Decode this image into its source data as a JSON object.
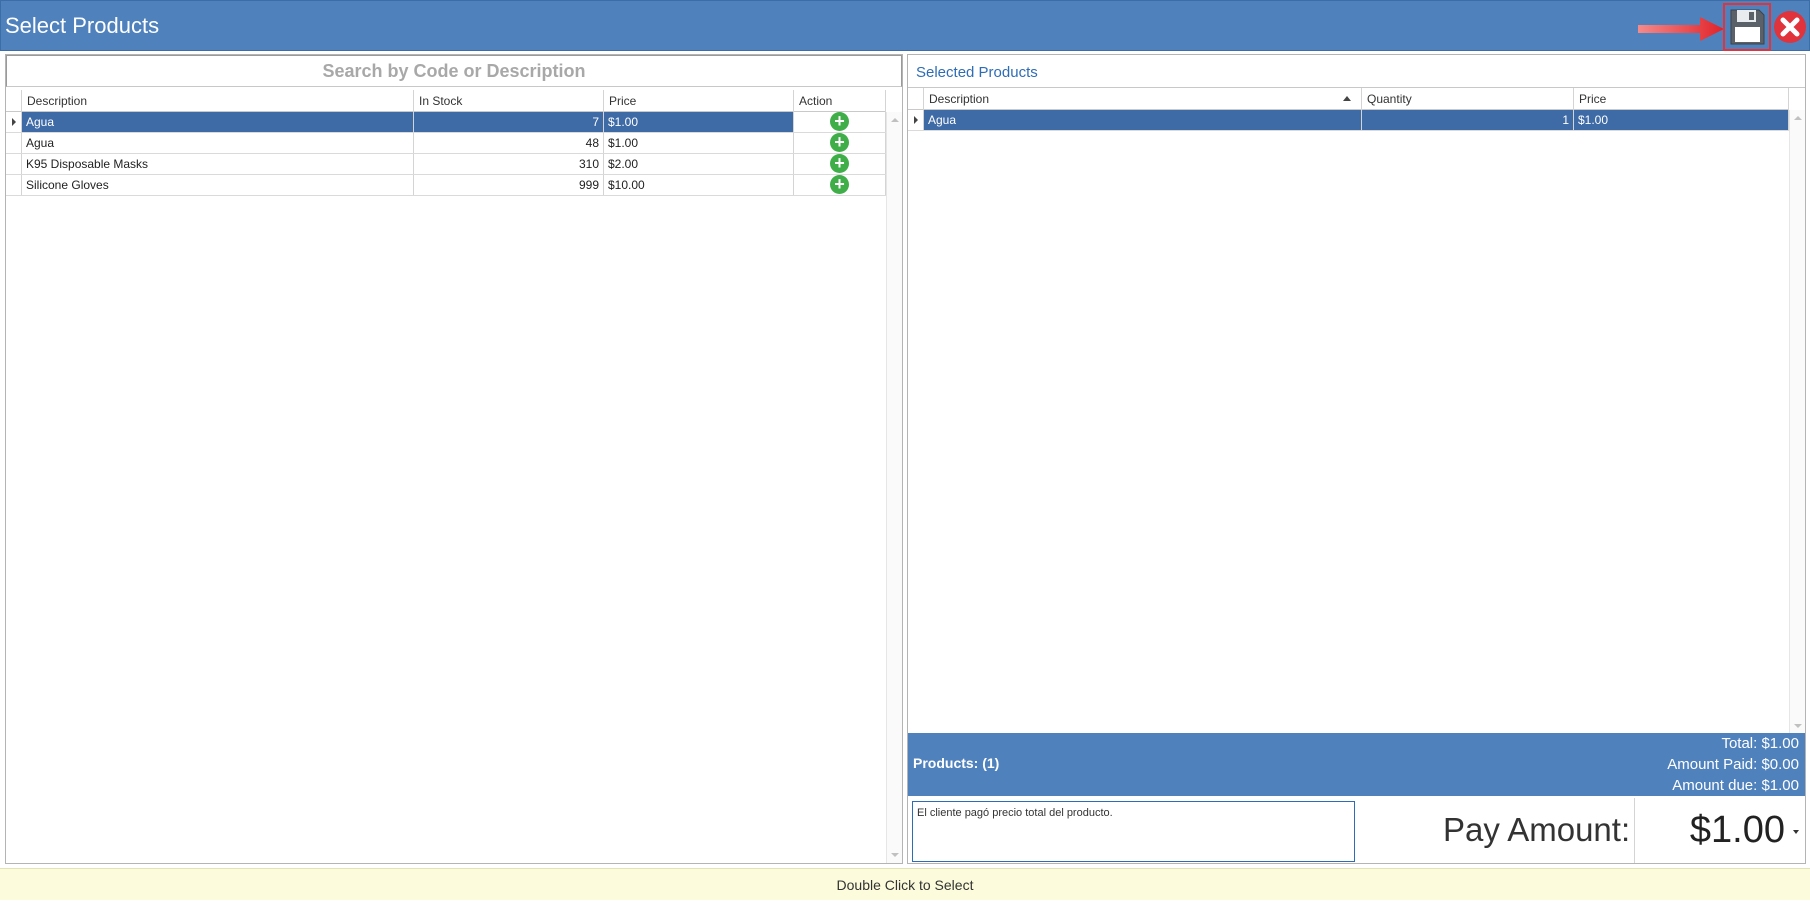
{
  "window": {
    "title": "Select Products"
  },
  "colors": {
    "accent": "#4f81bd",
    "selected_row": "#3e6aa6",
    "add_icon": "#3fae49",
    "close_icon": "#e0333c",
    "status_bg": "#fcfcdc"
  },
  "search": {
    "placeholder": "Search by Code or Description"
  },
  "product_grid": {
    "columns": {
      "description": "Description",
      "in_stock": "In Stock",
      "price": "Price",
      "action": "Action"
    },
    "rows": [
      {
        "description": "Agua",
        "in_stock": "7",
        "price": "$1.00"
      },
      {
        "description": "Agua",
        "in_stock": "48",
        "price": "$1.00"
      },
      {
        "description": "K95 Disposable Masks",
        "in_stock": "310",
        "price": "$2.00"
      },
      {
        "description": "Silicone Gloves",
        "in_stock": "999",
        "price": "$10.00"
      }
    ],
    "action_icon": "add-circle-icon"
  },
  "selected": {
    "title": "Selected Products",
    "columns": {
      "description": "Description",
      "quantity": "Quantity",
      "price": "Price"
    },
    "rows": [
      {
        "description": "Agua",
        "quantity": "1",
        "price": "$1.00"
      }
    ]
  },
  "summary": {
    "products": "Products: (1)",
    "total": "Total: $1.00",
    "amount_paid": "Amount Paid: $0.00",
    "amount_due": "Amount due: $1.00"
  },
  "notes": {
    "value": "El cliente pagó precio total del producto."
  },
  "pay": {
    "label": "Pay Amount:",
    "value": "$1.00"
  },
  "status": {
    "text": "Double Click to Select"
  },
  "icons": {
    "save": "floppy-disk-icon",
    "close": "close-icon",
    "annotation": "red-arrow-icon"
  }
}
